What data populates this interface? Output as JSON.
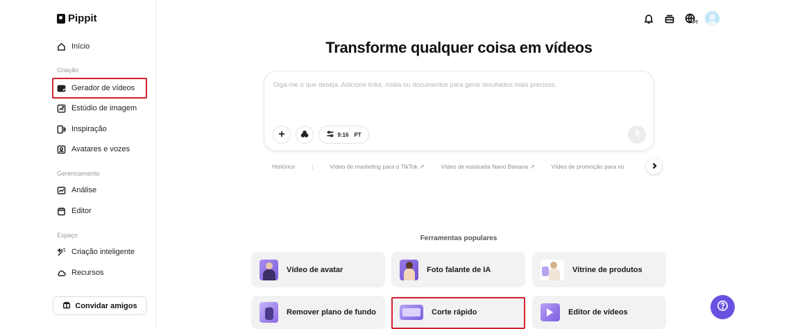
{
  "app": {
    "name": "Pippit"
  },
  "sidebar": {
    "home": "Início",
    "sections": {
      "creation": "Criação",
      "management": "Gerenciamento",
      "space": "Espaço"
    },
    "items": [
      {
        "label": "Gerador de vídeos",
        "icon": "video-generator-icon"
      },
      {
        "label": "Estúdio de imagem",
        "icon": "image-studio-icon"
      },
      {
        "label": "Inspiração",
        "icon": "inspiration-icon"
      },
      {
        "label": "Avatares e vozes",
        "icon": "avatar-voice-icon"
      },
      {
        "label": "Análise",
        "icon": "analytics-icon"
      },
      {
        "label": "Editor",
        "icon": "editor-icon"
      },
      {
        "label": "Criação inteligente",
        "icon": "smart-creation-icon"
      },
      {
        "label": "Recursos",
        "icon": "cloud-icon"
      }
    ],
    "invite_label": "Convidar amigos"
  },
  "header": {
    "language_badge": "PT"
  },
  "main": {
    "headline": "Transforme qualquer coisa em vídeos",
    "prompt_placeholder": "Diga-me o que deseja. Adicione links, mídia ou documentos para gerar resultados mais precisos.",
    "aspect_ratio": "9:16",
    "language": "PT",
    "history_label": "Histórico",
    "suggestions": [
      "Vídeo de marketing para o TikTok ↗",
      "Vídeo de estatueta Nano Banana ↗",
      "Vídeo de promoção para vo"
    ],
    "tools_title": "Ferramentas populares",
    "tools": [
      {
        "label": "Vídeo de avatar"
      },
      {
        "label": "Foto falante de IA"
      },
      {
        "label": "Vitrine de produtos"
      },
      {
        "label": "Remover plano de fundo"
      },
      {
        "label": "Corte rápido"
      },
      {
        "label": "Editor de vídeos"
      }
    ]
  },
  "colors": {
    "accent": "#6a50e0",
    "highlight": "#d2202e",
    "card_bg": "#f2f2f2"
  }
}
